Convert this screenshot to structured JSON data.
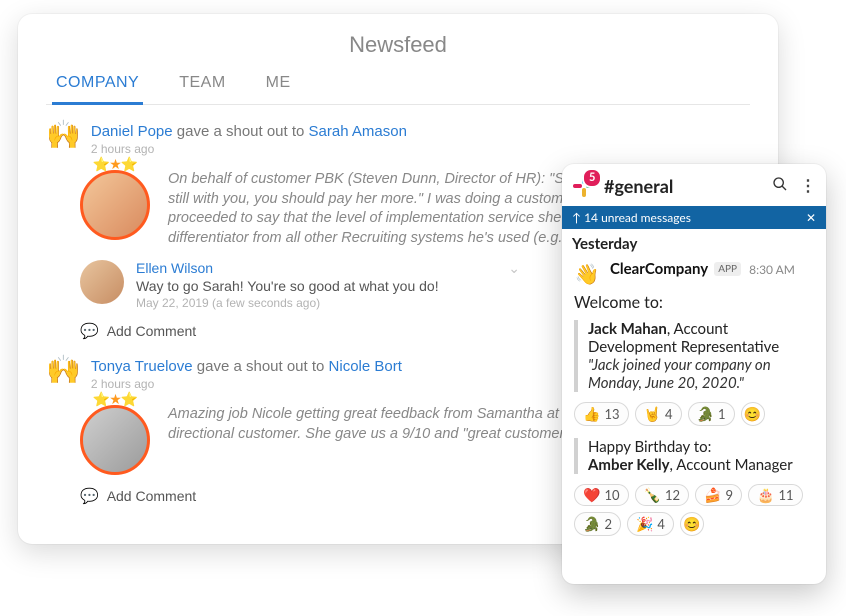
{
  "newsfeed": {
    "title": "Newsfeed",
    "tabs": [
      "COMPANY",
      "TEAM",
      "ME"
    ],
    "active_tab": 0,
    "items": [
      {
        "actor": "Daniel Pope",
        "action": " gave a shout out to ",
        "target": "Sarah Amason",
        "time": "2 hours ago",
        "shout_text": "On behalf of customer PBK (Steven Dunn, Director of HR): \"Sarah is tremendous. If she's still with you, you should pay her more.\" I was doing a customer interview and he then proceeded to say that the level of implementation service she provided was a clear differentiator from all other Recruiting systems he's used (e.g. Taleo).",
        "comments": [
          {
            "author": "Ellen Wilson",
            "text": "Way to go Sarah! You're so good at what you do!",
            "meta": "May 22, 2019 (a few seconds ago)"
          }
        ],
        "add_comment_label": "Add Comment"
      },
      {
        "actor": "Tonya Truelove",
        "action": " gave a shout out to ",
        "target": "Nicole Bort",
        "time": "2 hours ago",
        "shout_text": "Amazing job Nicole getting great feedback from Samantha at Monarch Tractor an ADP Bi-directional customer. She gave us a 9/10 and \"great customer service - loved Nicole Bort!\"",
        "add_comment_label": "Add Comment"
      }
    ]
  },
  "slack": {
    "badge_count": "5",
    "channel": "#general",
    "unread_text": "14 unread messages",
    "day_label": "Yesterday",
    "sender": "ClearCompany",
    "app_label": "APP",
    "time": "8:30 AM",
    "welcome_label": "Welcome to:",
    "welcome_block": {
      "name": "Jack Mahan",
      "role": ", Account Development Representative",
      "quote": "\"Jack joined your company on Monday, June 20, 2020.\""
    },
    "reactions1": [
      {
        "emoji": "👍",
        "count": "13"
      },
      {
        "emoji": "🤘",
        "count": "4"
      },
      {
        "emoji": "🐊",
        "count": "1"
      }
    ],
    "birthday_label": "Happy Birthday to:",
    "birthday_block": {
      "name": "Amber Kelly",
      "role": ", Account Manager"
    },
    "reactions2": [
      {
        "emoji": "❤️",
        "count": "10"
      },
      {
        "emoji": "🍾",
        "count": "12"
      },
      {
        "emoji": "🍰",
        "count": "9"
      },
      {
        "emoji": "🎂",
        "count": "11"
      },
      {
        "emoji": "🐊",
        "count": "2"
      },
      {
        "emoji": "🎉",
        "count": "4"
      }
    ]
  }
}
